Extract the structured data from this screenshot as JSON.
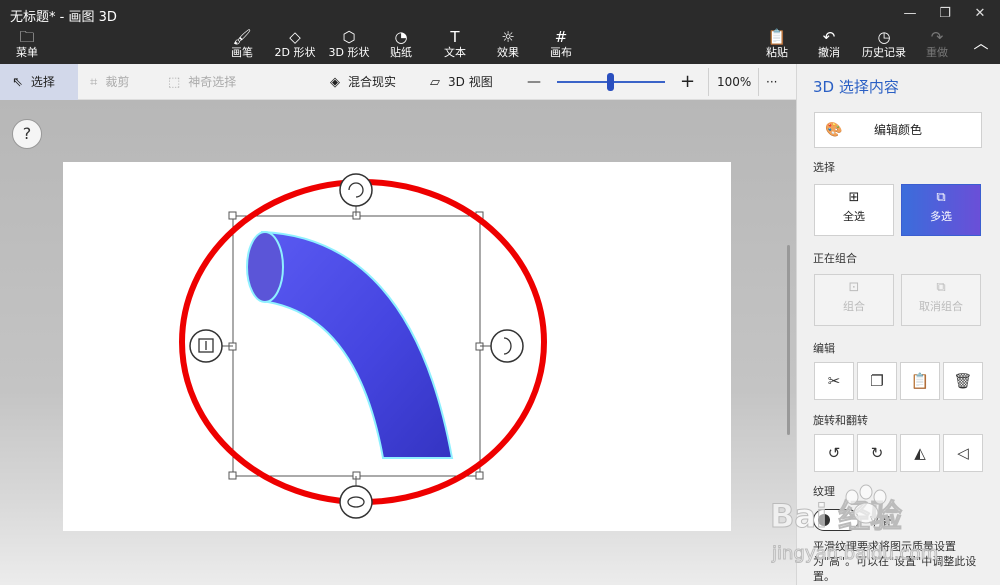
{
  "window": {
    "title": "无标题* - 画图 3D",
    "minimize_icon": "minimize-icon",
    "restore_icon": "restore-icon",
    "close_icon": "close-icon"
  },
  "ribbon": {
    "menu": "菜单",
    "brushes": "画笔",
    "shapes2d": "2D 形状",
    "shapes3d": "3D 形状",
    "stickers": "贴纸",
    "text": "文本",
    "effects": "效果",
    "canvas": "画布",
    "paste": "粘贴",
    "undo": "撤消",
    "history": "历史记录",
    "redo": "重做"
  },
  "toolbar": {
    "select": "选择",
    "crop": "裁剪",
    "magic_select": "神奇选择",
    "mixed_reality": "混合现实",
    "view3d": "3D 视图",
    "zoom_minus": "—",
    "zoom_plus": "+",
    "zoom": "100%",
    "more": "···"
  },
  "canvas": {
    "help": "?",
    "shape_color": "#4a4ae6",
    "selection_ring_color": "#ee0000"
  },
  "panel": {
    "title": "3D 选择内容",
    "edit_color": "编辑颜色",
    "select_label": "选择",
    "select_all": "全选",
    "multi_select": "多选",
    "grouping_label": "正在组合",
    "group": "组合",
    "ungroup": "取消组合",
    "edit_label": "编辑",
    "rotate_label": "旋转和翻转",
    "texture_label": "纹理",
    "texture_state": "平滑",
    "note": "平滑纹理要求将图示质量设置为\"高\"。可以在\"设置\"中调整此设置。"
  },
  "watermark": {
    "brand": "Bai 经验",
    "url": "jingyan.baidu.com"
  }
}
